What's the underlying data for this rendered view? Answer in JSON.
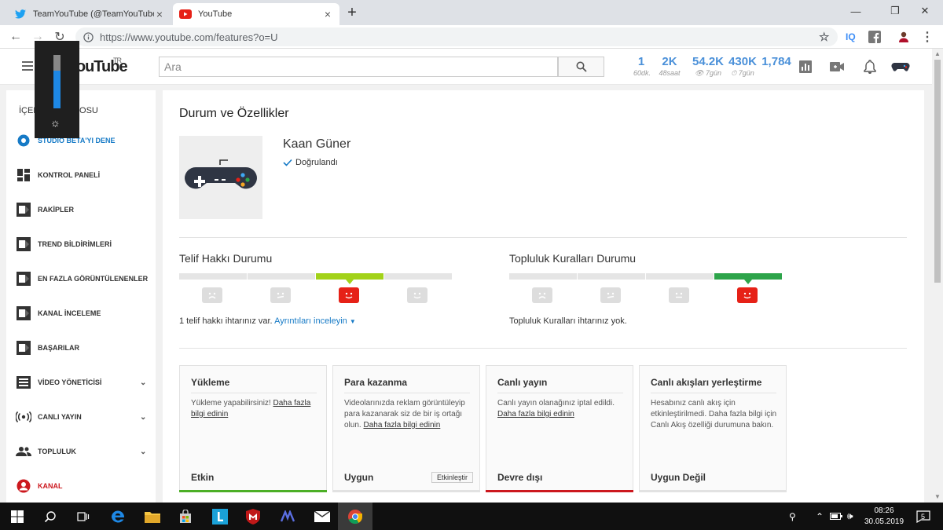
{
  "browser": {
    "tabs": [
      {
        "title": "TeamYouTube (@TeamYouTube) · ",
        "close": "×"
      },
      {
        "title": "YouTube",
        "close": "×"
      }
    ],
    "new_tab": "+",
    "url": "https://www.youtube.com/features?o=U",
    "extensions": {
      "iq": "IQ"
    },
    "window_controls": {
      "minimize": "—",
      "maximize": "❐",
      "close": "✕"
    }
  },
  "header": {
    "logo_text": "YouTube",
    "region": "TR",
    "search_placeholder": "Ara",
    "stats": [
      {
        "value": "1",
        "label": "60dk."
      },
      {
        "value": "2K",
        "label": "48saat"
      },
      {
        "value": "54.2K",
        "label": "👁 7gün"
      },
      {
        "value": "430K",
        "label": "⏱ 7gün"
      },
      {
        "value": "1,784",
        "label": ""
      }
    ]
  },
  "brightness": {
    "level": 0.7
  },
  "sidebar": {
    "title": "İÇERİK STÜDYOSU",
    "items": [
      {
        "label": "STUDIO BETA'YI DENE",
        "icon": "gear-icon"
      },
      {
        "label": "KONTROL PANELİ",
        "icon": "dashboard-icon"
      },
      {
        "label": "RAKİPLER",
        "icon": "vidiq-icon"
      },
      {
        "label": "TREND BİLDİRİMLERİ",
        "icon": "vidiq-icon"
      },
      {
        "label": "EN FAZLA GÖRÜNTÜLENENLER",
        "icon": "vidiq-icon"
      },
      {
        "label": "KANAL İNCELEME",
        "icon": "vidiq-icon"
      },
      {
        "label": "BAŞARILAR",
        "icon": "vidiq-icon"
      },
      {
        "label": "VİDEO YÖNETİCİSİ",
        "icon": "video-manager-icon"
      },
      {
        "label": "CANLI YAYIN",
        "icon": "live-icon"
      },
      {
        "label": "TOPLULUK",
        "icon": "community-icon"
      },
      {
        "label": "KANAL",
        "icon": "channel-icon"
      }
    ]
  },
  "main": {
    "title": "Durum ve Özellikler",
    "channel_name": "Kaan Güner",
    "verified_label": "Doğrulandı",
    "copyright": {
      "heading": "Telif Hakkı Durumu",
      "active_index": 2,
      "status_text": "1 telif hakkı ihtarınız var.",
      "details_link": "Ayrıntıları inceleyin"
    },
    "community": {
      "heading": "Topluluk Kuralları Durumu",
      "active_index": 3,
      "status_text": "Topluluk Kuralları ihtarınız yok."
    },
    "cards": [
      {
        "title": "Yükleme",
        "body": "Yükleme yapabilirsiniz!",
        "link": "Daha fazla bilgi edinin",
        "status": "Etkin",
        "color": "#4caf26"
      },
      {
        "title": "Para kazanma",
        "body": "Videolarınızda reklam görüntüleyip para kazanarak siz de bir iş ortağı olun.",
        "link": "Daha fazla bilgi edinin",
        "status": "Uygun",
        "button": "Etkinleştir",
        "color": "#e2e2e2"
      },
      {
        "title": "Canlı yayın",
        "body": "Canlı yayın olanağınız iptal edildi.",
        "link": "Daha fazla bilgi edinin",
        "status": "Devre dışı",
        "color": "#cc181e"
      },
      {
        "title": "Canlı akışları yerleştirme",
        "body": "Hesabınız canlı akış için etkinleştirilmedi. Daha fazla bilgi için Canlı Akış özelliği durumuna bakın.",
        "link": "",
        "status": "Uygun Değil",
        "color": "#e2e2e2"
      }
    ]
  },
  "taskbar": {
    "time": "08:26",
    "date": "30.05.2019",
    "notification_count": "5"
  },
  "colors": {
    "accent_blue": "#167ac6",
    "youtube_red": "#e62117",
    "lime": "#a2d219",
    "green": "#2da44a"
  }
}
